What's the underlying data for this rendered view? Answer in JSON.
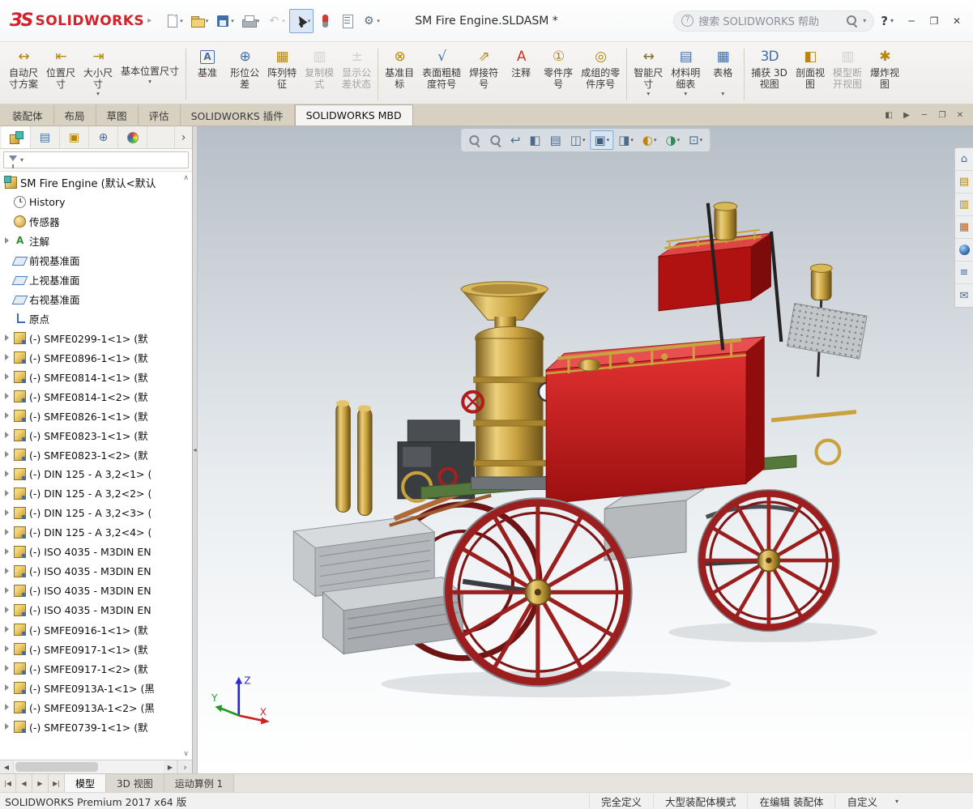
{
  "titlebar": {
    "logo_mark": "ЗS",
    "logo_text": "SOLIDWORKS",
    "title": "SM Fire Engine.SLDASM *",
    "search_placeholder": "搜索 SOLIDWORKS 帮助",
    "help_label": "?",
    "window": {
      "minimize": "─",
      "restore": "❐",
      "close": "✕"
    },
    "qat": [
      {
        "name": "new-document-button",
        "k": "new",
        "caret": true
      },
      {
        "name": "open-document-button",
        "k": "open",
        "caret": true
      },
      {
        "name": "save-document-button",
        "k": "save",
        "caret": true
      },
      {
        "name": "print-document-button",
        "k": "print",
        "caret": true
      },
      {
        "name": "undo-button",
        "k": "undo",
        "glyph": "↶",
        "caret": true,
        "disabled": true
      },
      {
        "name": "select-tool-button",
        "k": "select",
        "caret": true,
        "pressed": true
      },
      {
        "name": "rebuild-button",
        "k": "rebuild"
      },
      {
        "name": "file-properties-button",
        "k": "fileprops"
      },
      {
        "name": "options-button",
        "k": "options",
        "glyph": "⚙",
        "caret": true
      }
    ]
  },
  "ribbon": {
    "buttons": [
      {
        "name": "auto-dimension-scheme-button",
        "label1": "自动尺",
        "label2": "寸方案",
        "glyph": "↔",
        "color": "#b8860b"
      },
      {
        "name": "location-dimension-button",
        "label1": "位置尺",
        "label2": "寸",
        "glyph": "⇤",
        "color": "#b8860b"
      },
      {
        "name": "size-dimension-button",
        "label1": "大小尺",
        "label2": "寸",
        "glyph": "⇥",
        "color": "#b8860b",
        "caret": true
      },
      {
        "name": "basic-location-dimension-button",
        "label1": "基本位置尺寸",
        "noicon": true,
        "wide": true,
        "caret": true,
        "sep": true
      },
      {
        "name": "datum-button",
        "label1": "基准",
        "glyph": "A",
        "color": "#3f6fa8",
        "boxed": true
      },
      {
        "name": "geometric-tolerance-button",
        "label1": "形位公",
        "label2": "差",
        "glyph": "⊕",
        "color": "#3f6fa8"
      },
      {
        "name": "pattern-feature-button",
        "label1": "阵列特",
        "label2": "征",
        "glyph": "▦",
        "color": "#b8860b"
      },
      {
        "name": "copy-scheme-button",
        "label1": "复制模",
        "label2": "式",
        "glyph": "▥",
        "color": "#9aa4ac",
        "disabled": true
      },
      {
        "name": "show-tolerance-status-button",
        "label1": "显示公",
        "label2": "差状态",
        "glyph": "±",
        "color": "#9aa4ac",
        "disabled": true,
        "sep": true
      },
      {
        "name": "datum-target-button",
        "label1": "基准目",
        "label2": "标",
        "glyph": "⊗",
        "color": "#b8860b"
      },
      {
        "name": "surface-finish-button",
        "label1": "表面粗糙",
        "label2": "度符号",
        "glyph": "√",
        "color": "#3f6fa8"
      },
      {
        "name": "weld-symbol-button",
        "label1": "焊接符",
        "label2": "号",
        "glyph": "⇗",
        "color": "#b8860b"
      },
      {
        "name": "note-button",
        "label1": "注释",
        "glyph": "A",
        "color": "#c0392b"
      },
      {
        "name": "balloon-button",
        "label1": "零件序",
        "label2": "号",
        "glyph": "①",
        "color": "#b8860b"
      },
      {
        "name": "auto-balloon-button",
        "label1": "成组的零",
        "label2": "件序号",
        "glyph": "◎",
        "color": "#b8860b",
        "sep": true
      },
      {
        "name": "smart-dimension-button",
        "label1": "智能尺",
        "label2": "寸",
        "glyph": "↔",
        "color": "#8a6d1f",
        "caret": true
      },
      {
        "name": "bom-button",
        "label1": "材料明",
        "label2": "细表",
        "glyph": "▤",
        "color": "#3f6fa8",
        "caret": true
      },
      {
        "name": "tables-button",
        "label1": "表格",
        "glyph": "▦",
        "color": "#3f6fa8",
        "caret": true,
        "sep": true
      },
      {
        "name": "capture-3d-view-button",
        "label1": "捕获 3D",
        "label2": "视图",
        "glyph": "3D",
        "color": "#3f6fa8"
      },
      {
        "name": "section-view-button",
        "label1": "剖面视",
        "label2": "图",
        "glyph": "◧",
        "color": "#b8860b"
      },
      {
        "name": "model-break-view-button",
        "label1": "模型断",
        "label2": "开视图",
        "glyph": "▥",
        "color": "#9aa4ac",
        "disabled": true
      },
      {
        "name": "exploded-view-button",
        "label1": "爆炸视",
        "label2": "图",
        "glyph": "✱",
        "color": "#b8860b"
      }
    ]
  },
  "command_bar": {
    "tabs": [
      {
        "label": "装配体"
      },
      {
        "label": "布局"
      },
      {
        "label": "草图"
      },
      {
        "label": "评估"
      },
      {
        "label": "SOLIDWORKS 插件"
      },
      {
        "label": "SOLIDWORKS MBD",
        "active": true
      }
    ],
    "controls": [
      {
        "name": "dock-panel-left-button",
        "glyph": "◧"
      },
      {
        "name": "dock-panel-right-button",
        "glyph": "▶"
      },
      {
        "name": "minimize-panel-button",
        "glyph": "─"
      },
      {
        "name": "restore-panel-button",
        "glyph": "❐"
      },
      {
        "name": "close-panel-button",
        "glyph": "✕"
      }
    ]
  },
  "panel": {
    "tabs": [
      {
        "name": "featuremanager-tab",
        "k": "fm",
        "active": true
      },
      {
        "name": "propertymanager-tab",
        "k": "pm",
        "glyph": "▤",
        "color": "#3f6fa8"
      },
      {
        "name": "configurationmanager-tab",
        "k": "cfg",
        "glyph": "▣",
        "color": "#b8860b"
      },
      {
        "name": "dimxpertmanager-tab",
        "k": "dx",
        "glyph": "⊕",
        "color": "#3f6fa8"
      },
      {
        "name": "displaymanager-tab",
        "k": "dm"
      },
      {
        "name": "panel-tab-overflow",
        "k": "more",
        "glyph": "›",
        "color": "#555555"
      }
    ],
    "scroll_up": "∧",
    "scroll_down": "∨"
  },
  "tree": {
    "root": {
      "label": "SM Fire Engine  (默认<默认",
      "icon": "asm"
    },
    "items": [
      {
        "icon": "history",
        "label": "History"
      },
      {
        "icon": "sensor",
        "label": "传感器"
      },
      {
        "icon": "annot",
        "label": "注解",
        "expand": true
      },
      {
        "icon": "plane",
        "label": "前视基准面"
      },
      {
        "icon": "plane",
        "label": "上视基准面"
      },
      {
        "icon": "plane",
        "label": "右视基准面"
      },
      {
        "icon": "origin",
        "label": "原点"
      },
      {
        "icon": "comp",
        "label": "(-) SMFE0299-1<1> (默",
        "expand": true
      },
      {
        "icon": "comp",
        "label": "(-) SMFE0896-1<1> (默",
        "expand": true
      },
      {
        "icon": "comp",
        "label": "(-) SMFE0814-1<1> (默",
        "expand": true
      },
      {
        "icon": "comp",
        "label": "(-) SMFE0814-1<2> (默",
        "expand": true
      },
      {
        "icon": "comp",
        "label": "(-) SMFE0826-1<1> (默",
        "expand": true
      },
      {
        "icon": "comp",
        "label": "(-) SMFE0823-1<1> (默",
        "expand": true
      },
      {
        "icon": "comp",
        "label": "(-) SMFE0823-1<2> (默",
        "expand": true
      },
      {
        "icon": "comp",
        "label": "(-) DIN 125 - A 3,2<1> (",
        "expand": true
      },
      {
        "icon": "comp",
        "label": "(-) DIN 125 - A 3,2<2> (",
        "expand": true
      },
      {
        "icon": "comp",
        "label": "(-) DIN 125 - A 3,2<3> (",
        "expand": true
      },
      {
        "icon": "comp",
        "label": "(-) DIN 125 - A 3,2<4> (",
        "expand": true
      },
      {
        "icon": "comp",
        "label": "(-) ISO 4035 - M3DIN EN",
        "expand": true
      },
      {
        "icon": "comp",
        "label": "(-) ISO 4035 - M3DIN EN",
        "expand": true
      },
      {
        "icon": "comp",
        "label": "(-) ISO 4035 - M3DIN EN",
        "expand": true
      },
      {
        "icon": "comp",
        "label": "(-) ISO 4035 - M3DIN EN",
        "expand": true
      },
      {
        "icon": "comp",
        "label": "(-) SMFE0916-1<1> (默",
        "expand": true
      },
      {
        "icon": "comp",
        "label": "(-) SMFE0917-1<1> (默",
        "expand": true
      },
      {
        "icon": "comp",
        "label": "(-) SMFE0917-1<2> (默",
        "expand": true
      },
      {
        "icon": "comp",
        "label": "(-) SMFE0913A-1<1> (黑",
        "expand": true
      },
      {
        "icon": "comp",
        "label": "(-) SMFE0913A-1<2> (黑",
        "expand": true
      },
      {
        "icon": "comp",
        "label": "(-) SMFE0739-1<1> (默",
        "expand": true
      }
    ]
  },
  "headsup": {
    "items": [
      {
        "name": "zoom-fit-button",
        "mag": true
      },
      {
        "name": "zoom-area-button",
        "mag": true
      },
      {
        "name": "previous-view-button",
        "glyph": "↩",
        "color": "#4a6b8a"
      },
      {
        "name": "section-view-tool-button",
        "glyph": "◧",
        "color": "#4a6b8a"
      },
      {
        "name": "dynamic-annotation-views-button",
        "glyph": "▤",
        "color": "#4a6b8a"
      },
      {
        "name": "hide-show-items-button",
        "glyph": "◫",
        "color": "#4a6b8a",
        "caret": true
      },
      {
        "name": "view-orientation-button",
        "glyph": "▣",
        "color": "#3f5f7f",
        "caret": true,
        "pressed": true
      },
      {
        "name": "display-style-button",
        "glyph": "◨",
        "color": "#4a6b8a",
        "caret": true
      },
      {
        "name": "edit-appearance-button",
        "glyph": "◐",
        "color": "#b8860b",
        "caret": true
      },
      {
        "name": "apply-scene-button",
        "glyph": "◑",
        "color": "#2e8b57",
        "caret": true
      },
      {
        "name": "view-settings-button",
        "glyph": "⊡",
        "color": "#4a6b8a",
        "caret": true
      }
    ]
  },
  "taskpane": {
    "items": [
      {
        "name": "solidworks-resources-tab",
        "glyph": "⌂",
        "color": "#3f6fa8"
      },
      {
        "name": "design-library-tab",
        "glyph": "▤",
        "color": "#b8860b"
      },
      {
        "name": "file-explorer-tab",
        "glyph": "▥",
        "color": "#b8860b"
      },
      {
        "name": "view-palette-tab",
        "glyph": "▦",
        "color": "#c06020"
      },
      {
        "name": "appearances-scenes-tab",
        "k": "sphere"
      },
      {
        "name": "custom-properties-tab",
        "glyph": "≡",
        "color": "#3f6fa8"
      },
      {
        "name": "forum-tab",
        "glyph": "✉",
        "color": "#4a6b8a"
      }
    ]
  },
  "viewport": {
    "triad": {
      "x": "X",
      "y": "Y",
      "z": "Z"
    }
  },
  "bottom_bar": {
    "nav": [
      {
        "name": "first-tab-button",
        "glyph": "|◀"
      },
      {
        "name": "prev-tab-button",
        "glyph": "◀"
      },
      {
        "name": "next-tab-button",
        "glyph": "▶"
      },
      {
        "name": "last-tab-button",
        "glyph": "▶|"
      }
    ],
    "tabs": [
      {
        "label": "模型",
        "active": true
      },
      {
        "label": "3D 视图"
      },
      {
        "label": "运动算例 1"
      }
    ]
  },
  "statusbar": {
    "left": "SOLIDWORKS Premium 2017 x64 版",
    "items": [
      "完全定义",
      "大型装配体模式",
      "在编辑 装配体",
      "自定义"
    ]
  },
  "model": {
    "name": "fire-engine",
    "colors": {
      "body_red": "#c41414",
      "brass": "#c9a23f",
      "wheel_red": "#9b1f1f",
      "chassis_green": "#55783c",
      "metal_gray": "#b7babd"
    }
  }
}
